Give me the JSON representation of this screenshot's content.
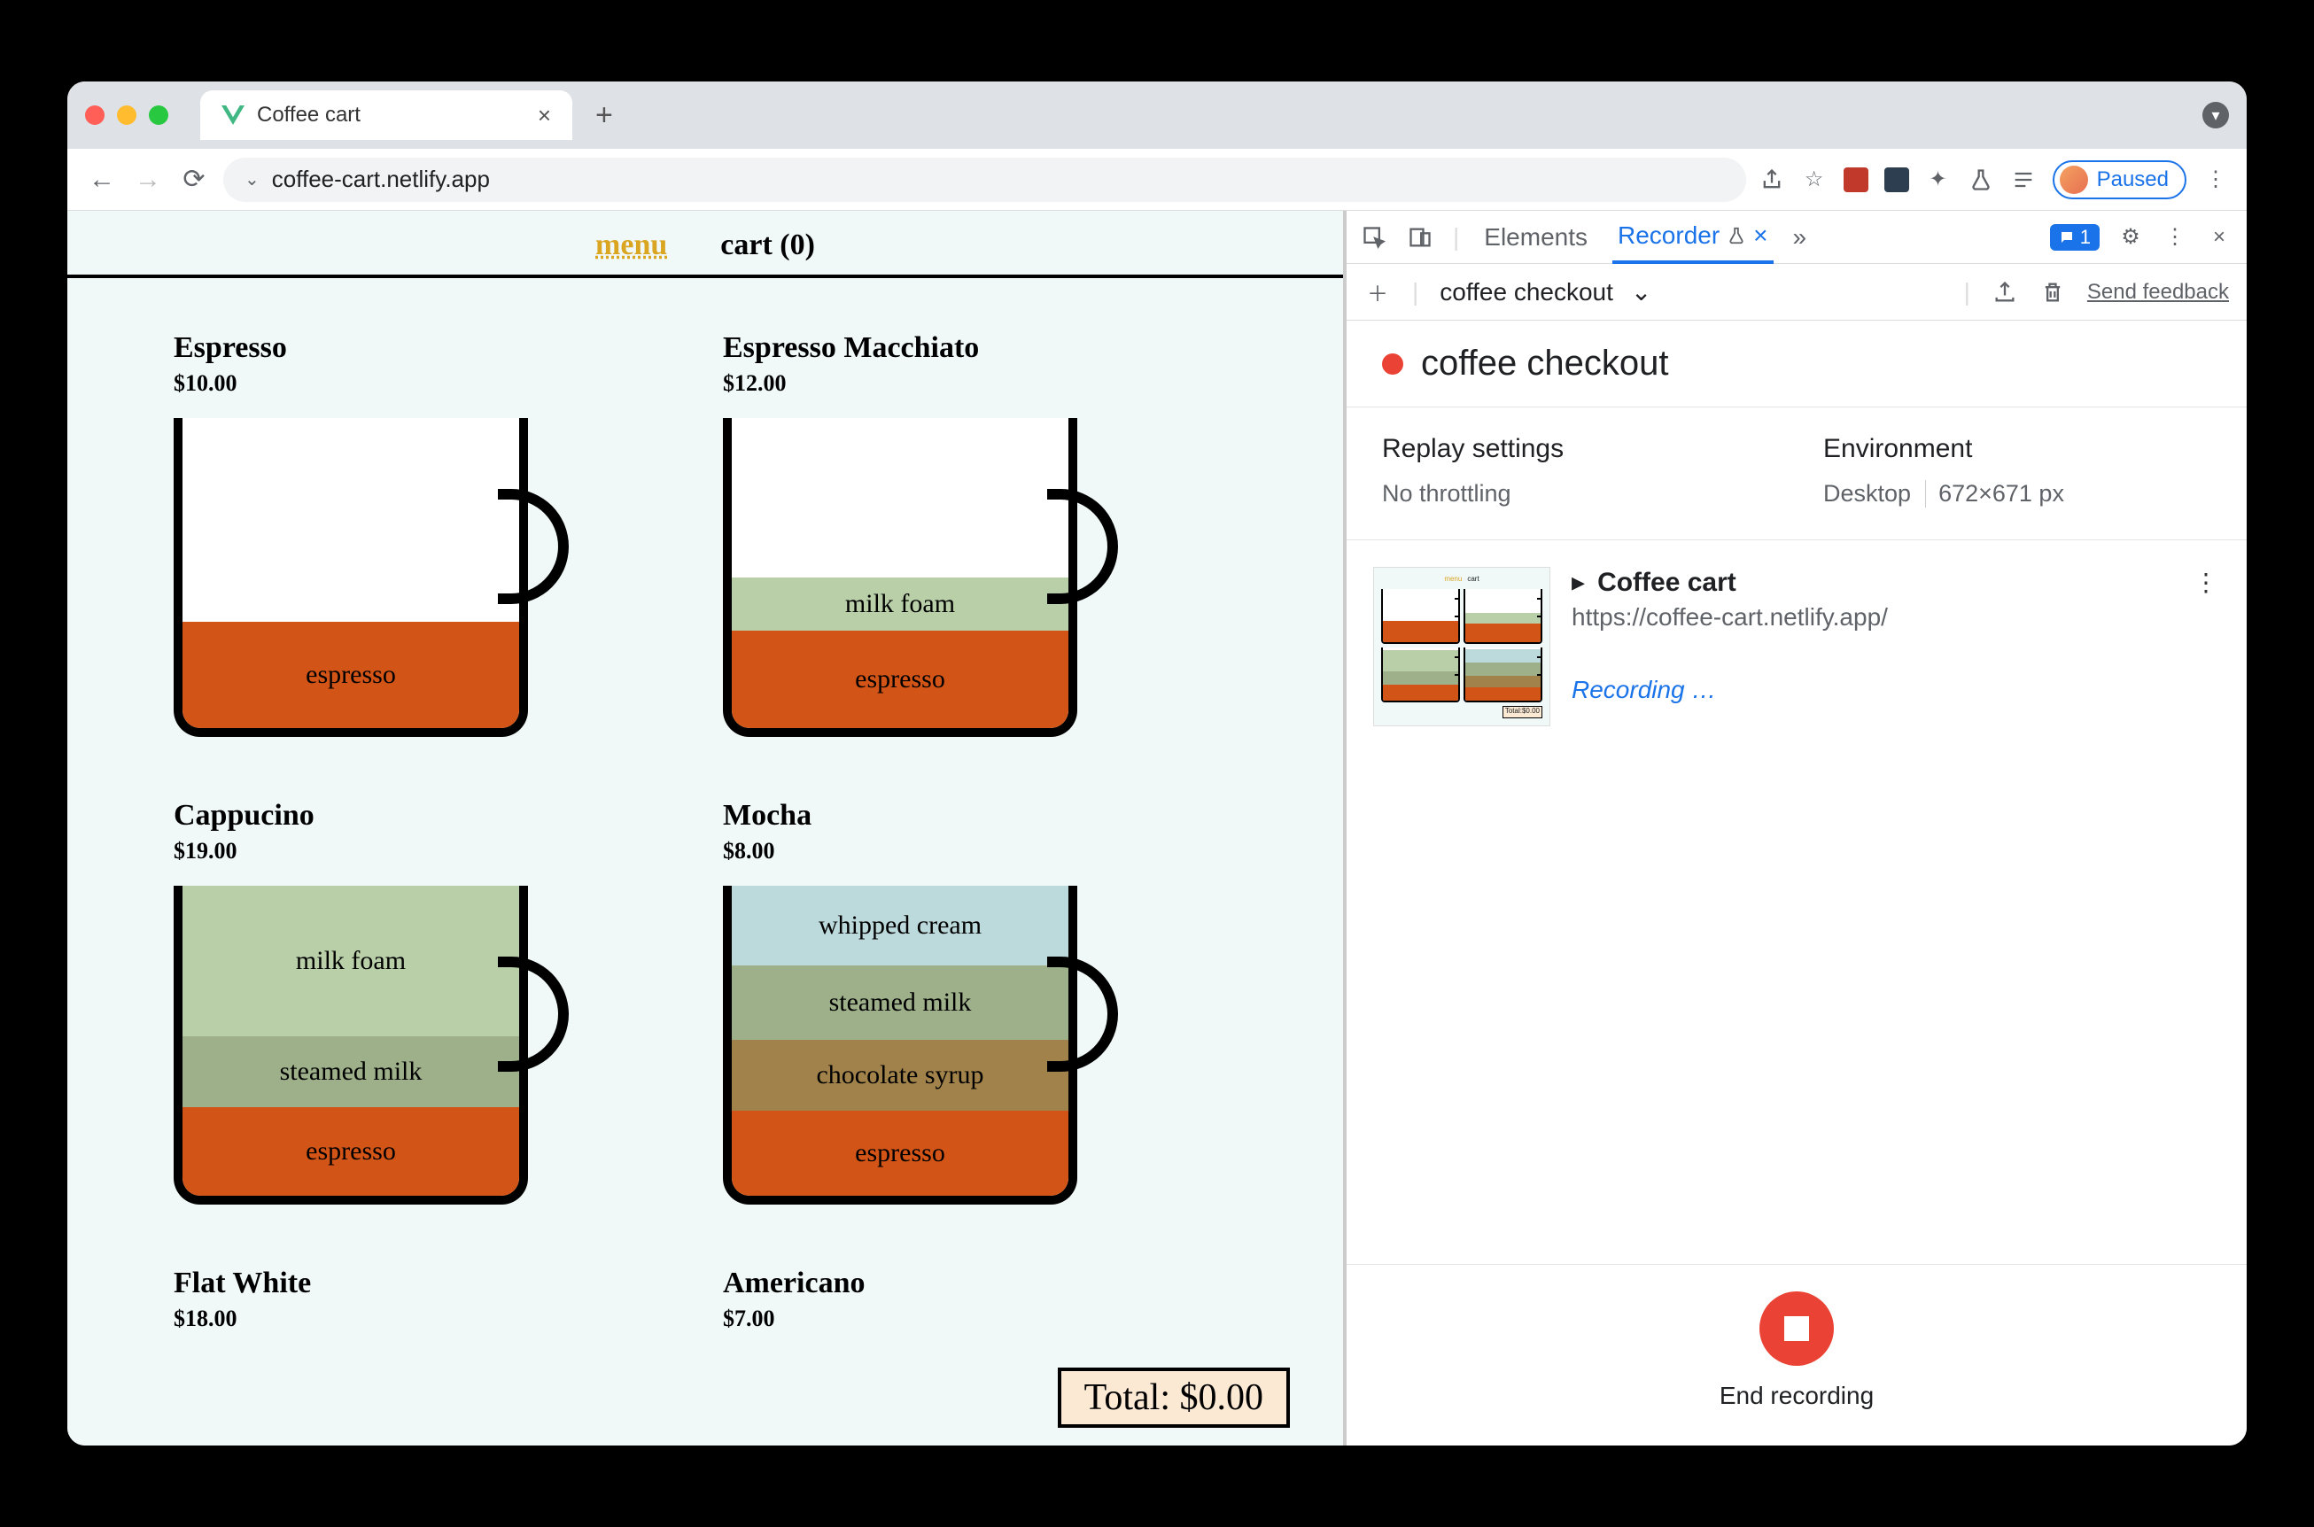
{
  "browser": {
    "tab_title": "Coffee cart",
    "url": "coffee-cart.netlify.app",
    "paused_label": "Paused"
  },
  "page": {
    "nav": {
      "menu": "menu",
      "cart": "cart (0)"
    },
    "total_label": "Total: $0.00",
    "products": [
      {
        "name": "Espresso",
        "price": "$10.00",
        "layers": [
          {
            "label": "espresso",
            "cls": "l-espresso",
            "h": 120
          }
        ]
      },
      {
        "name": "Espresso Macchiato",
        "price": "$12.00",
        "layers": [
          {
            "label": "milk foam",
            "cls": "l-milkfoam",
            "h": 60
          },
          {
            "label": "espresso",
            "cls": "l-espresso",
            "h": 110
          }
        ]
      },
      {
        "name": "Cappucino",
        "price": "$19.00",
        "layers": [
          {
            "label": "milk foam",
            "cls": "l-milkfoam",
            "h": 170
          },
          {
            "label": "steamed milk",
            "cls": "l-steamed",
            "h": 80
          },
          {
            "label": "espresso",
            "cls": "l-espresso",
            "h": 100
          }
        ]
      },
      {
        "name": "Mocha",
        "price": "$8.00",
        "layers": [
          {
            "label": "whipped cream",
            "cls": "l-whip",
            "h": 90
          },
          {
            "label": "steamed milk",
            "cls": "l-steamed",
            "h": 84
          },
          {
            "label": "chocolate syrup",
            "cls": "l-choc",
            "h": 80
          },
          {
            "label": "espresso",
            "cls": "l-espresso",
            "h": 96
          }
        ]
      },
      {
        "name": "Flat White",
        "price": "$18.00",
        "layers": []
      },
      {
        "name": "Americano",
        "price": "$7.00",
        "layers": []
      }
    ]
  },
  "devtools": {
    "tabs": {
      "elements": "Elements",
      "recorder": "Recorder"
    },
    "console_badge": "1",
    "recording_select": "coffee checkout",
    "send_feedback": "Send feedback",
    "title": "coffee checkout",
    "replay_h": "Replay settings",
    "replay_v": "No throttling",
    "env_h": "Environment",
    "env_device": "Desktop",
    "env_dims": "672×671 px",
    "step_title": "Coffee cart",
    "step_url": "https://coffee-cart.netlify.app/",
    "recording_label": "Recording …",
    "end_label": "End recording"
  }
}
